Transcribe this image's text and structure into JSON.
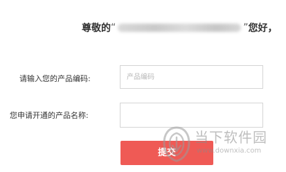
{
  "greeting": {
    "prefix": "尊敬的",
    "open_quote": "“",
    "close_quote": "”",
    "suffix": "您好，"
  },
  "form": {
    "product_code_label": "请输入您的产品编码:",
    "product_code_placeholder": "产品编码",
    "product_code_value": "",
    "product_name_label": "您申请开通的产品名称:",
    "product_name_value": "",
    "submit_label": "提交"
  },
  "watermark": {
    "brand_text": "当下软件园",
    "url": "www.downxia.com",
    "logo_icon": "downxia-logo-icon"
  }
}
